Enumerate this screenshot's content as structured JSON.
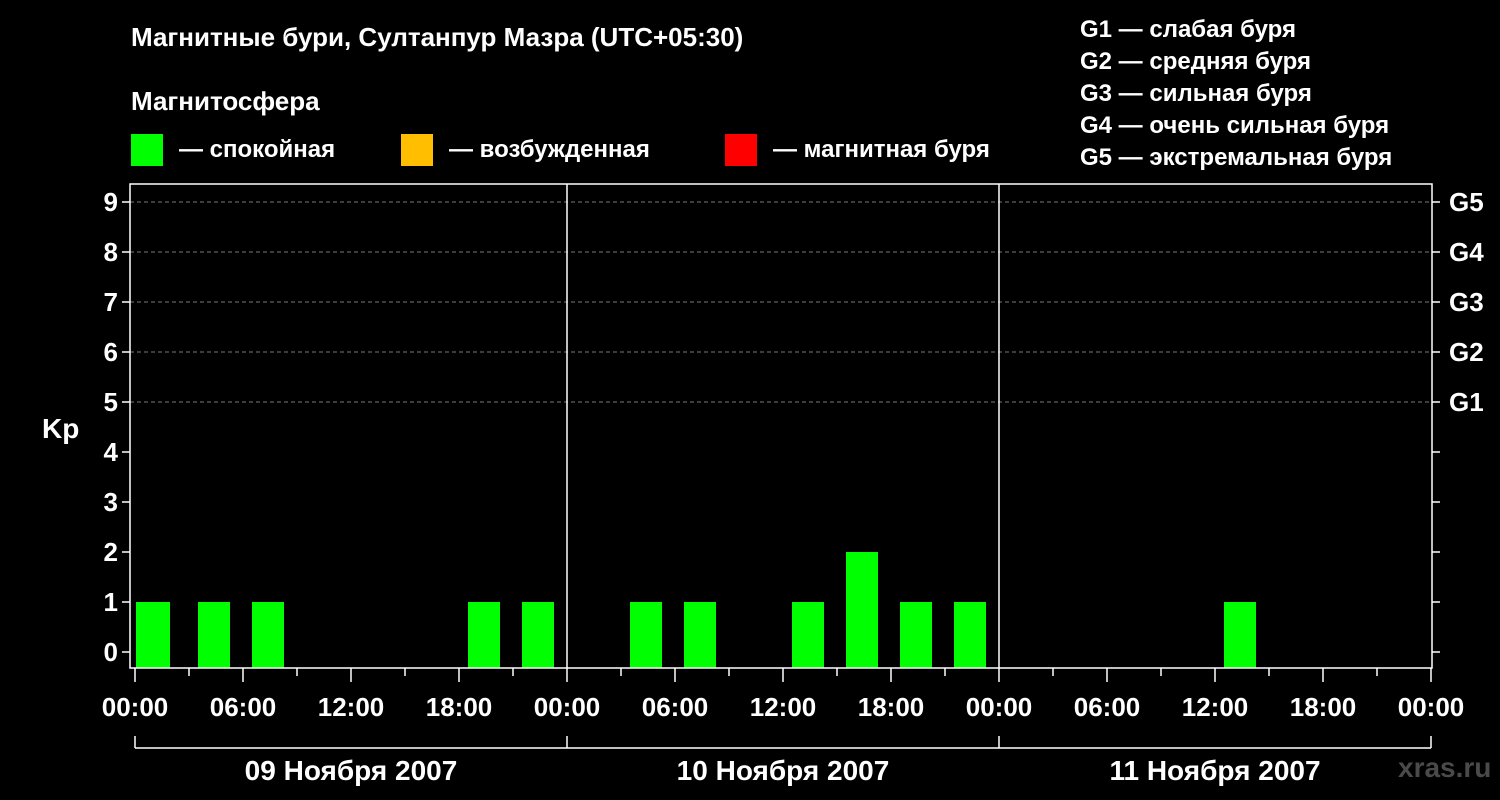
{
  "title": "Магнитные бури, Султанпур Мазра (UTC+05:30)",
  "subtitle": "Магнитосфера",
  "legend": [
    {
      "label": "— спокойная",
      "color": "#00ff00"
    },
    {
      "label": "— возбужденная",
      "color": "#ffbf00"
    },
    {
      "label": "— магнитная буря",
      "color": "#ff0000"
    }
  ],
  "g_legend": [
    "G1 — слабая буря",
    "G2 — средняя буря",
    "G3 — сильная буря",
    "G4 — очень сильная буря",
    "G5 — экстремальная буря"
  ],
  "watermark": "xras.ru",
  "chart_data": {
    "type": "bar",
    "ylabel": "Kp",
    "ylim": [
      0,
      9
    ],
    "y_ticks": [
      "0",
      "1",
      "2",
      "3",
      "4",
      "5",
      "6",
      "7",
      "8",
      "9"
    ],
    "right_ticks": [
      {
        "value": 5,
        "label": "G1"
      },
      {
        "value": 6,
        "label": "G2"
      },
      {
        "value": 7,
        "label": "G3"
      },
      {
        "value": 8,
        "label": "G4"
      },
      {
        "value": 9,
        "label": "G5"
      }
    ],
    "x_tick_labels": [
      "00:00",
      "06:00",
      "12:00",
      "18:00",
      "00:00",
      "06:00",
      "12:00",
      "18:00",
      "00:00",
      "06:00",
      "12:00",
      "18:00",
      "00:00"
    ],
    "days": [
      "09 Ноября 2007",
      "10 Ноября 2007",
      "11 Ноября 2007"
    ],
    "grid": "dashed at Kp 5–9",
    "bar_color": "#00ff00",
    "bars": [
      {
        "day": 0,
        "start_hour": 0,
        "end_hour": 3,
        "kp": 1
      },
      {
        "day": 0,
        "start_hour": 3,
        "end_hour": 6,
        "kp": 1
      },
      {
        "day": 0,
        "start_hour": 6,
        "end_hour": 9,
        "kp": 1
      },
      {
        "day": 0,
        "start_hour": 18,
        "end_hour": 21,
        "kp": 1
      },
      {
        "day": 0,
        "start_hour": 21,
        "end_hour": 24,
        "kp": 1
      },
      {
        "day": 1,
        "start_hour": 3,
        "end_hour": 6,
        "kp": 1
      },
      {
        "day": 1,
        "start_hour": 6,
        "end_hour": 9,
        "kp": 1
      },
      {
        "day": 1,
        "start_hour": 12,
        "end_hour": 15,
        "kp": 1
      },
      {
        "day": 1,
        "start_hour": 15,
        "end_hour": 18,
        "kp": 2
      },
      {
        "day": 1,
        "start_hour": 18,
        "end_hour": 21,
        "kp": 1
      },
      {
        "day": 1,
        "start_hour": 21,
        "end_hour": 24,
        "kp": 1
      },
      {
        "day": 2,
        "start_hour": 12,
        "end_hour": 15,
        "kp": 1
      }
    ]
  }
}
